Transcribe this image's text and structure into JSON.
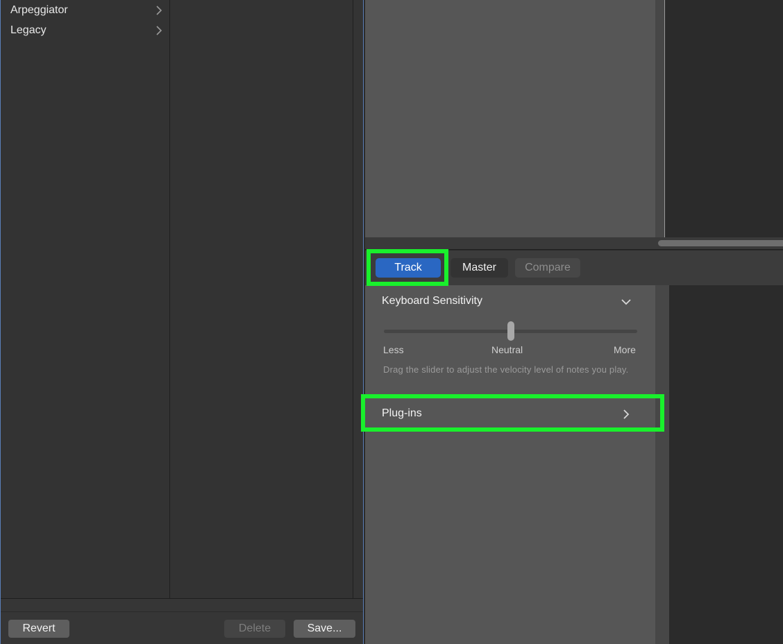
{
  "library": {
    "items": [
      {
        "label": "Arpeggiator",
        "icon": "chevron-right-icon"
      },
      {
        "label": "Legacy",
        "icon": "chevron-right-icon"
      }
    ],
    "footer": {
      "revert_label": "Revert",
      "delete_label": "Delete",
      "save_label": "Save..."
    }
  },
  "tabs": {
    "track_label": "Track",
    "master_label": "Master",
    "compare_label": "Compare",
    "active": "Track"
  },
  "inspector": {
    "keyboard_sensitivity": {
      "title": "Keyboard Sensitivity",
      "expanded": true,
      "slider": {
        "value": 0.5,
        "min_label": "Less",
        "mid_label": "Neutral",
        "max_label": "More"
      },
      "description": "Drag the slider to adjust the velocity level of notes you play."
    },
    "plugins": {
      "label": "Plug-ins",
      "icon": "chevron-right-icon"
    }
  },
  "colors": {
    "accent": "#2a67c2",
    "highlight": "#19f02c"
  }
}
